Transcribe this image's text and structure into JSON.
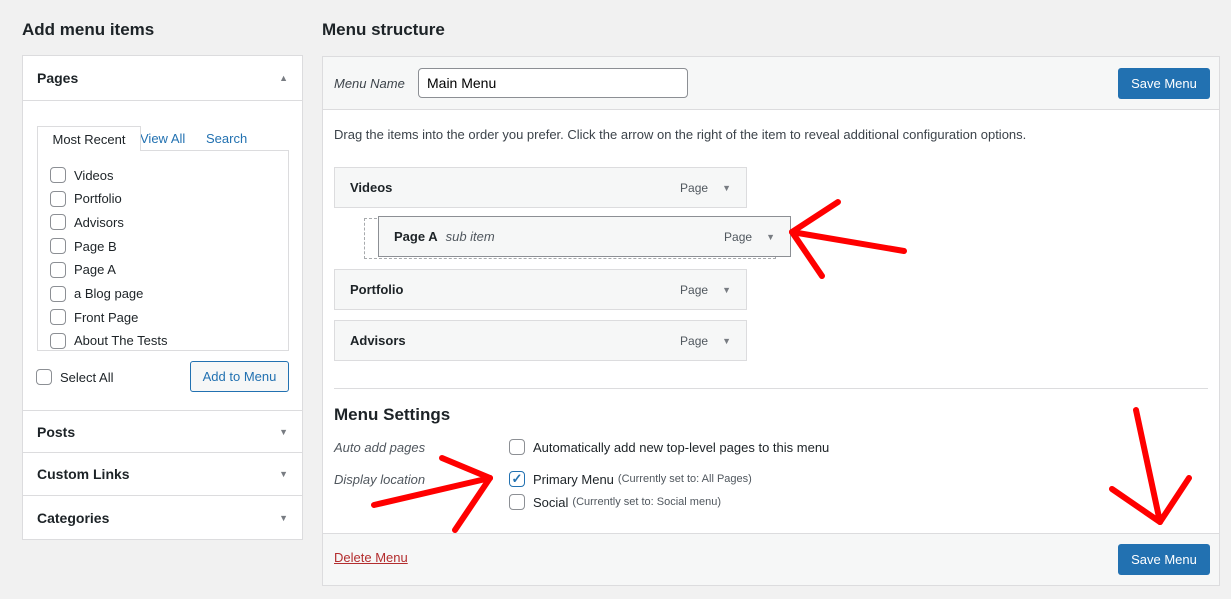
{
  "left": {
    "title": "Add menu items",
    "pages": {
      "title": "Pages",
      "tabs": [
        "Most Recent",
        "View All",
        "Search"
      ],
      "items": [
        "Videos",
        "Portfolio",
        "Advisors",
        "Page B",
        "Page A",
        "a Blog page",
        "Front Page",
        "About The Tests"
      ],
      "select_all": "Select All",
      "add_button": "Add to Menu"
    },
    "sections": [
      "Posts",
      "Custom Links",
      "Categories"
    ]
  },
  "right": {
    "title": "Menu structure",
    "menu_name_label": "Menu Name",
    "menu_name_value": "Main Menu",
    "save_label": "Save Menu",
    "instructions": "Drag the items into the order you prefer. Click the arrow on the right of the item to reveal additional configuration options.",
    "items": [
      {
        "title": "Videos",
        "type": "Page"
      },
      {
        "title": "Page A",
        "sub": "sub item",
        "type": "Page"
      },
      {
        "title": "Portfolio",
        "type": "Page"
      },
      {
        "title": "Advisors",
        "type": "Page"
      }
    ],
    "settings": {
      "title": "Menu Settings",
      "auto_label": "Auto add pages",
      "auto_text": "Automatically add new top-level pages to this menu",
      "display_label": "Display location",
      "locations": [
        {
          "name": "Primary Menu",
          "note": "(Currently set to: All Pages)",
          "checked": true
        },
        {
          "name": "Social",
          "note": "(Currently set to: Social menu)",
          "checked": false
        }
      ]
    },
    "delete_label": "Delete Menu"
  },
  "colors": {
    "accent": "#2271b1",
    "annotation": "#ff0000",
    "delete": "#b32d2e"
  }
}
